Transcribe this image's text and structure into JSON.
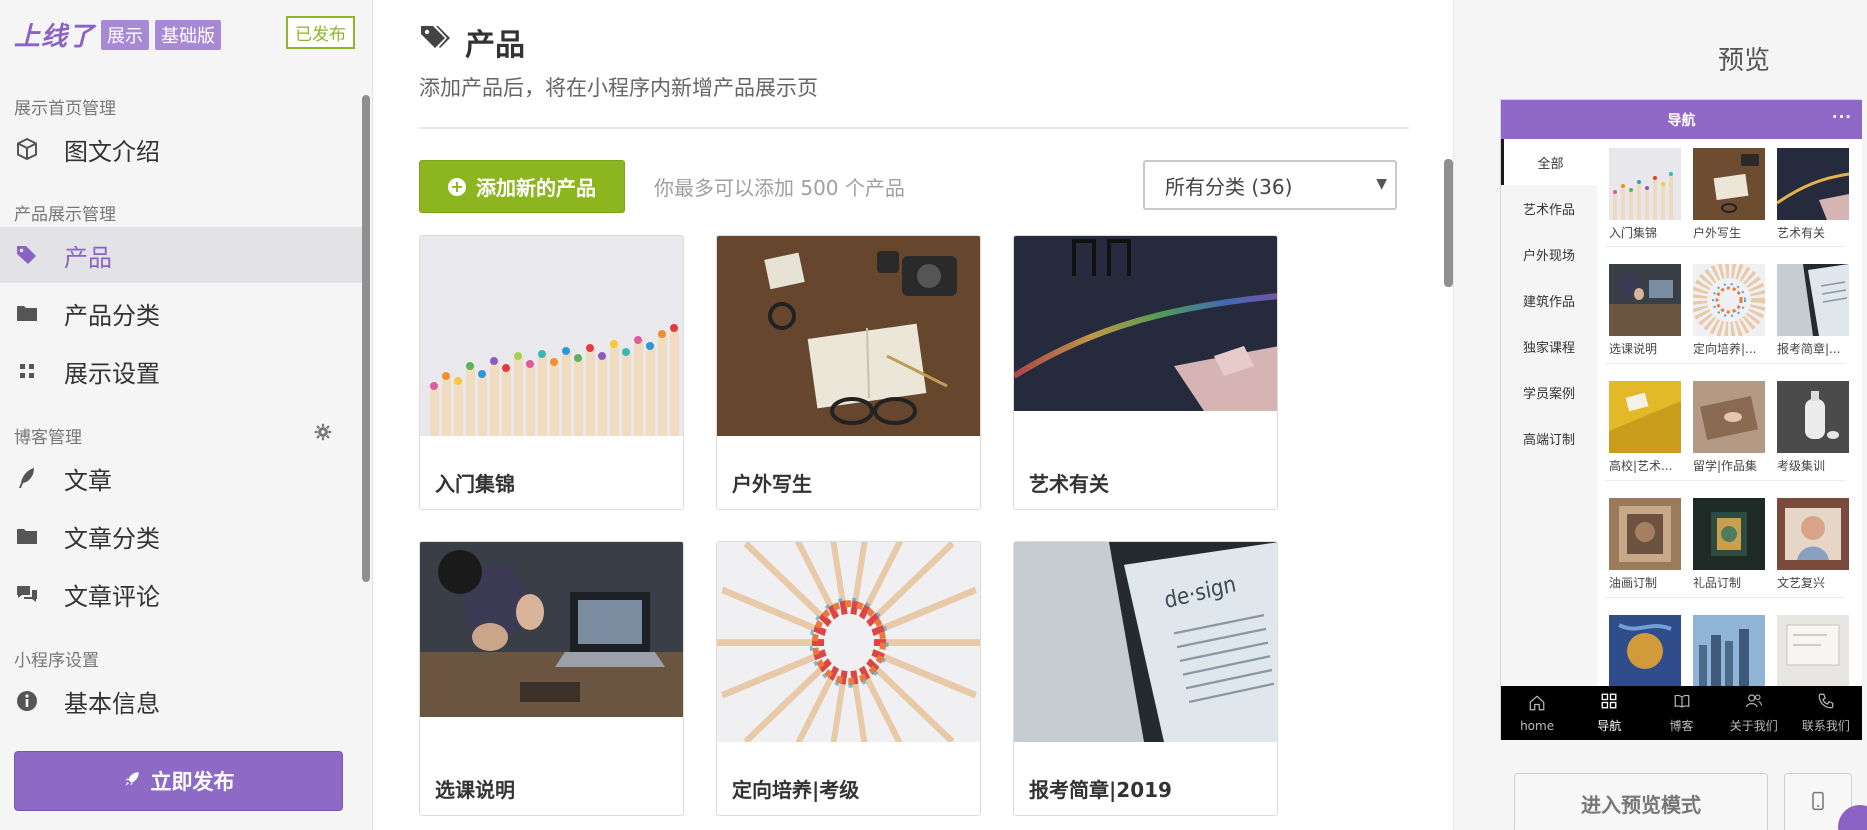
{
  "brand": {
    "logo": "上线了",
    "tag1": "展示",
    "tag2": "基础版",
    "status": "已发布"
  },
  "sidebar": {
    "sections": [
      {
        "title": "展示首页管理"
      },
      {
        "title": "产品展示管理"
      },
      {
        "title": "博客管理"
      },
      {
        "title": "小程序设置"
      }
    ],
    "items": [
      {
        "label": "图文介绍",
        "icon": "cube-icon"
      },
      {
        "label": "产品",
        "icon": "tags-icon",
        "active": true
      },
      {
        "label": "产品分类",
        "icon": "folder-icon"
      },
      {
        "label": "展示设置",
        "icon": "grid-icon"
      },
      {
        "label": "文章",
        "icon": "feather-icon"
      },
      {
        "label": "文章分类",
        "icon": "folder-icon"
      },
      {
        "label": "文章评论",
        "icon": "comments-icon"
      },
      {
        "label": "基本信息",
        "icon": "info-icon"
      }
    ],
    "publish_button": "立即发布"
  },
  "main": {
    "title": "产品",
    "subtitle": "添加产品后，将在小程序内新增产品展示页",
    "add_button": "添加新的产品",
    "limit_text": "你最多可以添加 500 个产品",
    "category_select": "所有分类 (36)",
    "products": [
      {
        "name": "入门集锦"
      },
      {
        "name": "户外写生"
      },
      {
        "name": "艺术有关"
      },
      {
        "name": "选课说明"
      },
      {
        "name": "定向培养|考级"
      },
      {
        "name": "报考简章|2019"
      }
    ]
  },
  "preview": {
    "title": "预览",
    "header": "导航",
    "header_more": "···",
    "nav": [
      "全部",
      "艺术作品",
      "户外现场",
      "建筑作品",
      "独家课程",
      "学员案例",
      "高端订制"
    ],
    "thumbs": [
      "入门集锦",
      "户外写生",
      "艺术有关",
      "选课说明",
      "定向培养|...",
      "报考简章|...",
      "高校|艺术...",
      "留学|作品集",
      "考级集训",
      "油画订制",
      "礼品订制",
      "文艺复兴"
    ],
    "tabbar": [
      {
        "label": "home",
        "icon": "home-icon"
      },
      {
        "label": "导航",
        "icon": "apps-icon",
        "active": true
      },
      {
        "label": "博客",
        "icon": "book-icon"
      },
      {
        "label": "关于我们",
        "icon": "users-icon"
      },
      {
        "label": "联系我们",
        "icon": "phone-icon"
      }
    ],
    "enter_preview_button": "进入预览模式"
  },
  "colors": {
    "accent": "#8b62c4",
    "green": "#8cb520",
    "status": "#8fb52a"
  }
}
